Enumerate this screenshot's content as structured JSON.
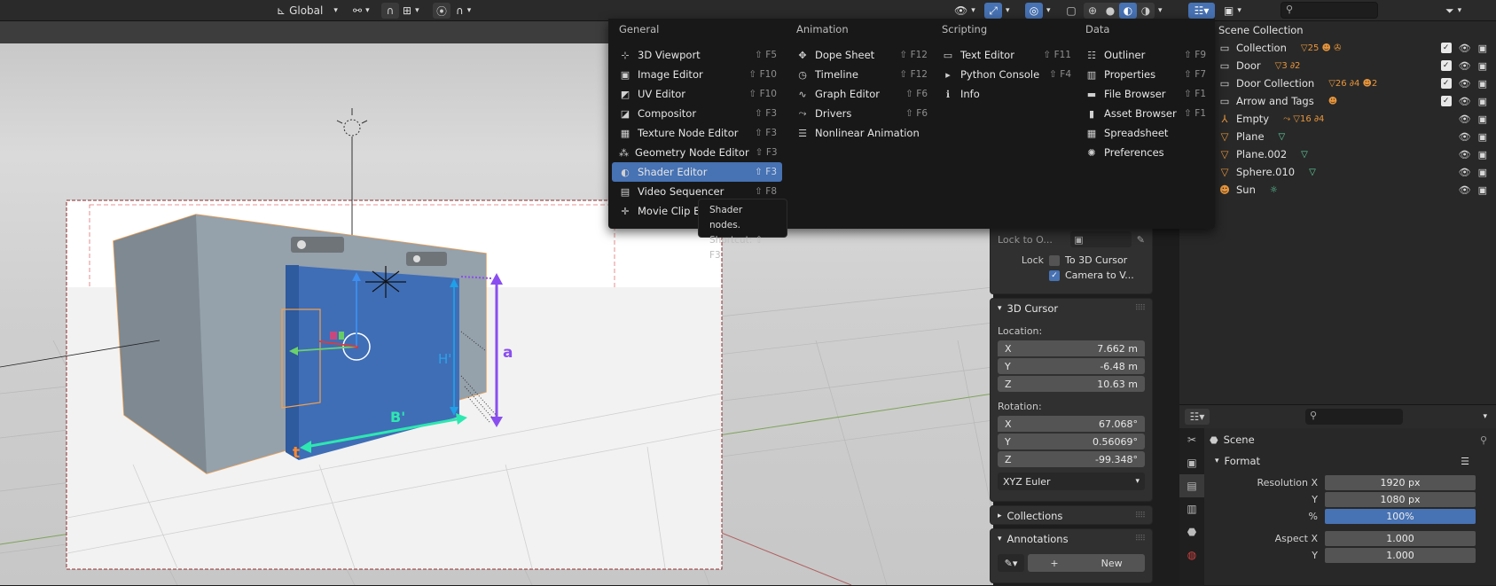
{
  "topbar": {
    "orientation": "Global",
    "search_placeholder": ""
  },
  "viewport": {
    "labels": {
      "b_prime": "B'",
      "h_prime": "H'",
      "a": "a",
      "t": "t"
    }
  },
  "npanel": {
    "lock_to_object_label": "Lock to O...",
    "lock_label": "Lock",
    "to_3d_cursor": "To 3D Cursor",
    "camera_to_view": "Camera to V...",
    "cursor": {
      "title": "3D Cursor",
      "location_label": "Location:",
      "location": [
        {
          "axis": "X",
          "value": "7.662 m"
        },
        {
          "axis": "Y",
          "value": "-6.48 m"
        },
        {
          "axis": "Z",
          "value": "10.63 m"
        }
      ],
      "rotation_label": "Rotation:",
      "rotation": [
        {
          "axis": "X",
          "value": "67.068°"
        },
        {
          "axis": "Y",
          "value": "0.56069°"
        },
        {
          "axis": "Z",
          "value": "-99.348°"
        }
      ],
      "rotation_mode": "XYZ Euler"
    },
    "collections_title": "Collections",
    "annotations_title": "Annotations",
    "annotations_new": "New"
  },
  "menu": {
    "columns": [
      {
        "header": "General",
        "items": [
          {
            "icon": "viewport-icon",
            "glyph": "⊹",
            "label": "3D Viewport",
            "shortcut": "⇧ F5"
          },
          {
            "icon": "image-icon",
            "glyph": "▣",
            "label": "Image Editor",
            "shortcut": "⇧ F10"
          },
          {
            "icon": "uv-icon",
            "glyph": "◩",
            "label": "UV Editor",
            "shortcut": "⇧ F10"
          },
          {
            "icon": "compositor-icon",
            "glyph": "◪",
            "label": "Compositor",
            "shortcut": "⇧ F3"
          },
          {
            "icon": "texture-icon",
            "glyph": "▦",
            "label": "Texture Node Editor",
            "shortcut": "⇧ F3"
          },
          {
            "icon": "geometry-icon",
            "glyph": "⁂",
            "label": "Geometry Node Editor",
            "shortcut": "⇧ F3"
          },
          {
            "icon": "shader-icon",
            "glyph": "◐",
            "label": "Shader Editor",
            "shortcut": "⇧ F3",
            "selected": true
          },
          {
            "icon": "sequencer-icon",
            "glyph": "▤",
            "label": "Video Sequencer",
            "shortcut": "⇧ F8"
          },
          {
            "icon": "clip-icon",
            "glyph": "✛",
            "label": "Movie Clip Editor",
            "shortcut": "⇧ F2"
          }
        ]
      },
      {
        "header": "Animation",
        "items": [
          {
            "icon": "dopesheet-icon",
            "glyph": "✥",
            "label": "Dope Sheet",
            "shortcut": "⇧ F12"
          },
          {
            "icon": "timeline-icon",
            "glyph": "◷",
            "label": "Timeline",
            "shortcut": "⇧ F12"
          },
          {
            "icon": "graph-icon",
            "glyph": "∿",
            "label": "Graph Editor",
            "shortcut": "⇧ F6"
          },
          {
            "icon": "drivers-icon",
            "glyph": "⤳",
            "label": "Drivers",
            "shortcut": "⇧ F6"
          },
          {
            "icon": "nla-icon",
            "glyph": "☰",
            "label": "Nonlinear Animation",
            "shortcut": ""
          }
        ]
      },
      {
        "header": "Scripting",
        "items": [
          {
            "icon": "text-icon",
            "glyph": "▭",
            "label": "Text Editor",
            "shortcut": "⇧ F11"
          },
          {
            "icon": "console-icon",
            "glyph": "▸",
            "label": "Python Console",
            "shortcut": "⇧ F4"
          },
          {
            "icon": "info-icon",
            "glyph": "ℹ",
            "label": "Info",
            "shortcut": ""
          }
        ]
      },
      {
        "header": "Data",
        "items": [
          {
            "icon": "outliner-icon",
            "glyph": "☷",
            "label": "Outliner",
            "shortcut": "⇧ F9"
          },
          {
            "icon": "properties-icon",
            "glyph": "▥",
            "label": "Properties",
            "shortcut": "⇧ F7"
          },
          {
            "icon": "folder-icon",
            "glyph": "▬",
            "label": "File Browser",
            "shortcut": "⇧ F1"
          },
          {
            "icon": "asset-icon",
            "glyph": "▮",
            "label": "Asset Browser",
            "shortcut": "⇧ F1"
          },
          {
            "icon": "spreadsheet-icon",
            "glyph": "▦",
            "label": "Spreadsheet",
            "shortcut": ""
          },
          {
            "icon": "preferences-icon",
            "glyph": "✺",
            "label": "Preferences",
            "shortcut": ""
          }
        ]
      }
    ]
  },
  "tooltip": {
    "description": "Shader nodes.",
    "shortcut": "Shortcut: ⇧ F3"
  },
  "outliner": {
    "title": "Scene Collection",
    "rows": [
      {
        "icon": "collection-icon",
        "glyph": "▭",
        "label": "Collection",
        "badges": "▽25 ☻ ✇",
        "checkbox": true
      },
      {
        "icon": "collection-icon",
        "glyph": "▭",
        "label": "Door",
        "badges": "▽3 ∂2",
        "checkbox": true
      },
      {
        "icon": "collection-icon",
        "glyph": "▭",
        "label": "Door Collection",
        "badges": "▽26 ∂4 ☻2",
        "checkbox": true
      },
      {
        "icon": "collection-icon",
        "glyph": "▭",
        "label": "Arrow and Tags",
        "badges": "☻",
        "checkbox": true
      },
      {
        "icon": "empty-icon",
        "glyph": "⅄",
        "label": "Empty",
        "badges": "⤳ ▽16 ∂4",
        "checkbox": false
      },
      {
        "icon": "mesh-icon",
        "glyph": "▽",
        "label": "Plane",
        "badges": "▽",
        "checkbox": false
      },
      {
        "icon": "mesh-icon",
        "glyph": "▽",
        "label": "Plane.002",
        "badges": "▽",
        "checkbox": false
      },
      {
        "icon": "mesh-icon",
        "glyph": "▽",
        "label": "Sphere.010",
        "badges": "▽",
        "checkbox": false
      },
      {
        "icon": "light-icon",
        "glyph": "☻",
        "label": "Sun",
        "badges": "☼",
        "checkbox": false
      }
    ]
  },
  "properties": {
    "scene_label": "Scene",
    "section": "Format",
    "fields": [
      {
        "label": "Resolution X",
        "value": "1920 px"
      },
      {
        "label": "Y",
        "value": "1080 px"
      },
      {
        "label": "%",
        "value": "100%",
        "highlight": true
      },
      {
        "label": "Aspect X",
        "value": "1.000"
      },
      {
        "label": "Y",
        "value": "1.000"
      }
    ]
  },
  "colors": {
    "accent": "#4772b3",
    "door_blue": "#3f6eb6",
    "arrow_purple": "#8a4ef0",
    "arrow_cyan": "#2de8b0",
    "selection_orange": "#f0a050"
  }
}
